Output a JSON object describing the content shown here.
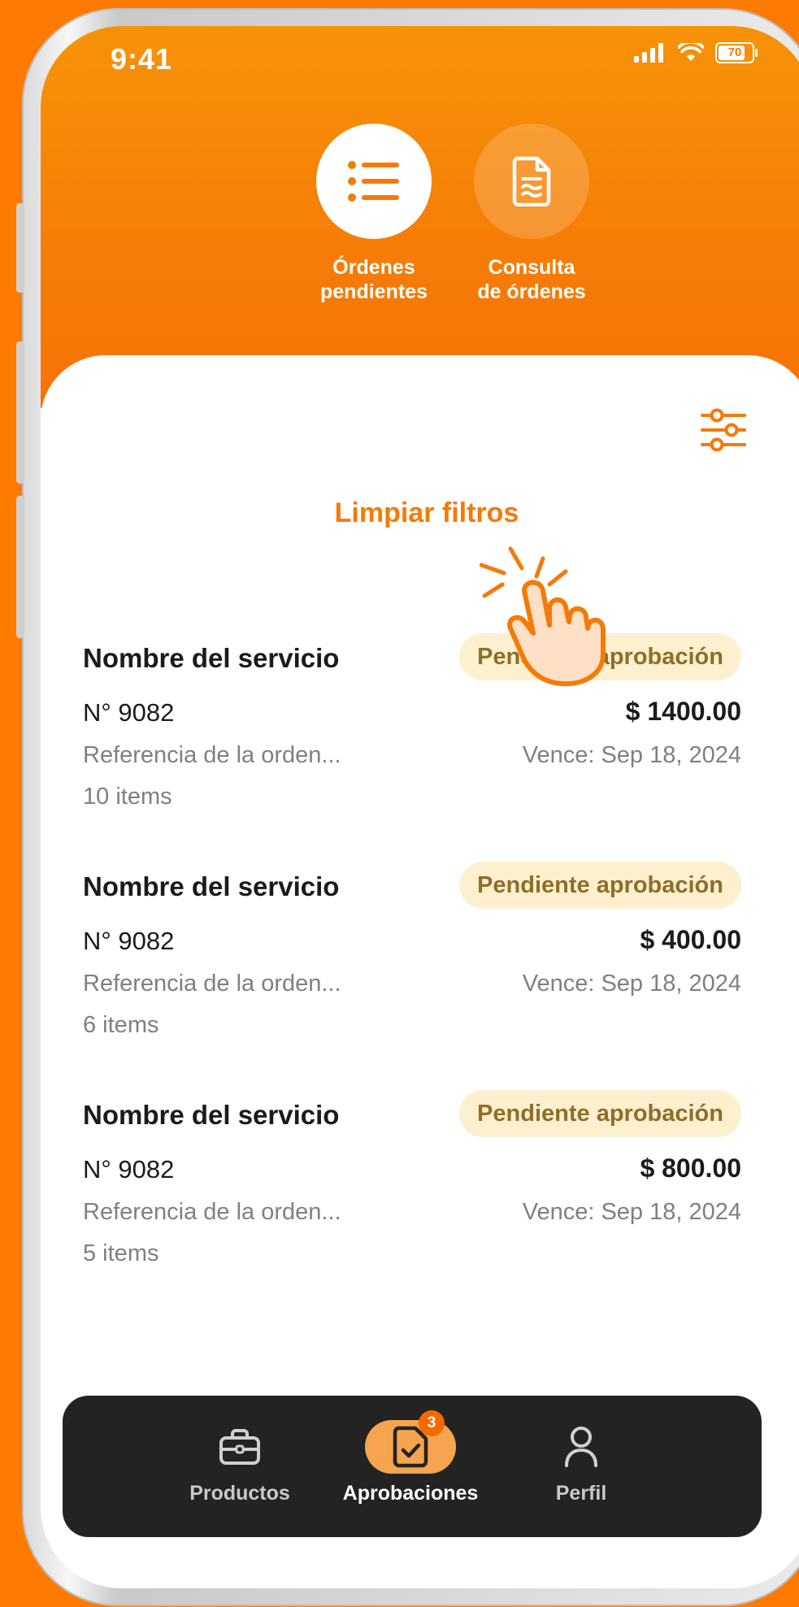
{
  "status_bar": {
    "time": "9:41",
    "battery": "70"
  },
  "top_tabs": [
    {
      "label": "Órdenes\npendientes",
      "icon": "list-icon",
      "active": true
    },
    {
      "label": "Consulta\nde órdenes",
      "icon": "document-icon",
      "active": false
    }
  ],
  "filters": {
    "clear_label": "Limpiar filtros",
    "icon": "sliders-icon"
  },
  "orders": [
    {
      "name": "Nombre del servicio",
      "status": "Pendiente aprobación",
      "number": "N° 9082",
      "amount": "$ 1400.00",
      "reference": "Referencia de la orden...",
      "due": "Vence: Sep 18, 2024",
      "items": "10 items"
    },
    {
      "name": "Nombre del servicio",
      "status": "Pendiente aprobación",
      "number": "N° 9082",
      "amount": "$ 400.00",
      "reference": "Referencia de la orden...",
      "due": "Vence: Sep 18, 2024",
      "items": "6 items"
    },
    {
      "name": "Nombre del servicio",
      "status": "Pendiente aprobación",
      "number": "N° 9082",
      "amount": "$ 800.00",
      "reference": "Referencia de la orden...",
      "due": "Vence: Sep 18, 2024",
      "items": "5 items"
    }
  ],
  "bottom_nav": [
    {
      "label": "Productos",
      "icon": "briefcase-icon",
      "active": false
    },
    {
      "label": "Aprobaciones",
      "icon": "document-check-icon",
      "active": true,
      "badge": "3"
    },
    {
      "label": "Perfil",
      "icon": "user-icon",
      "active": false
    }
  ],
  "colors": {
    "brand": "#f57a06",
    "badge_bg": "#fdf0cf",
    "badge_text": "#8e6e28",
    "nav_bg": "#232323"
  }
}
